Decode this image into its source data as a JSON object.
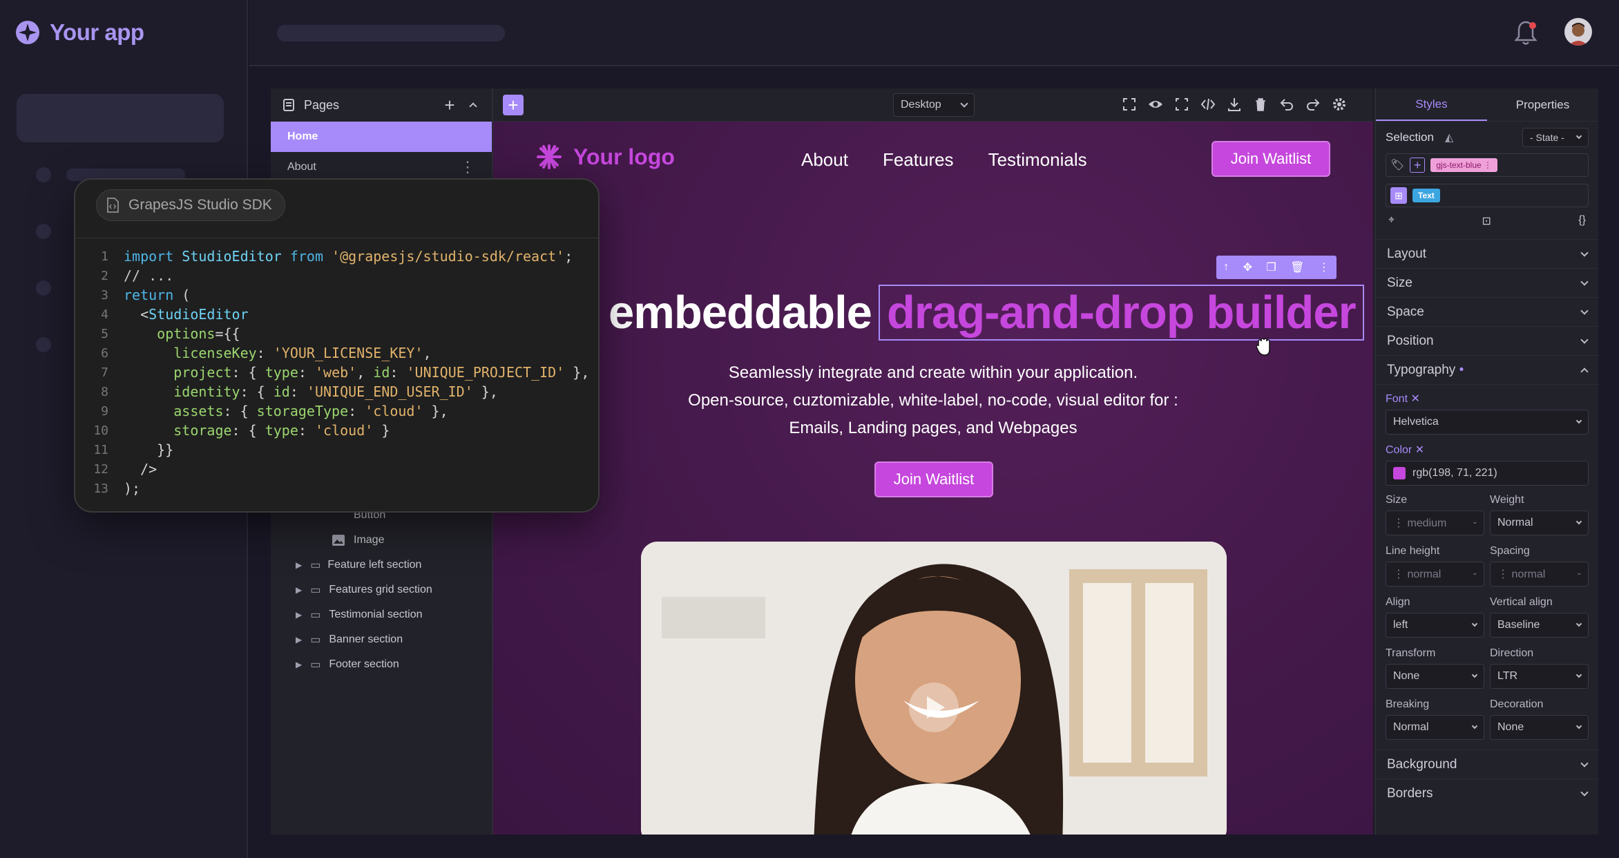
{
  "app": {
    "name": "Your app"
  },
  "pages_panel": {
    "title": "Pages",
    "pages": [
      {
        "label": "Home",
        "active": true
      },
      {
        "label": "About",
        "active": false
      }
    ],
    "layers": [
      {
        "label": "Button",
        "indent": 2
      },
      {
        "label": "Image",
        "indent": 2
      },
      {
        "label": "Feature left section",
        "indent": 1
      },
      {
        "label": "Features grid section",
        "indent": 1
      },
      {
        "label": "Testimonial section",
        "indent": 1
      },
      {
        "label": "Banner section",
        "indent": 1
      },
      {
        "label": "Footer section",
        "indent": 1
      }
    ]
  },
  "canvas_toolbar": {
    "device": "Desktop"
  },
  "site": {
    "logo": "Your logo",
    "nav": [
      "About",
      "Features",
      "Testimonials"
    ],
    "cta_label": "Join Waitlist",
    "hero_plain": "embeddable",
    "hero_highlight": "drag-and-drop builder",
    "subtitle": [
      "Seamlessly integrate and create within your application.",
      "Open-source, cuztomizable, white-label, no-code, visual editor for :",
      "Emails, Landing pages, and Webpages"
    ],
    "hero_button": "Join Waitlist"
  },
  "code_card": {
    "tab_label": "GrapesJS Studio SDK",
    "lines": [
      "1",
      "2",
      "3",
      "4",
      "5",
      "6",
      "7",
      "8",
      "9",
      "10",
      "11",
      "12",
      "13"
    ]
  },
  "right_panel": {
    "tabs": [
      "Styles",
      "Properties"
    ],
    "selection_label": "Selection",
    "state_label": "- State -",
    "class_tag": "gjs-text-blue",
    "component_tag": "Text",
    "sections_top": [
      "Layout",
      "Size",
      "Space",
      "Position"
    ],
    "typography": "Typography",
    "font_label": "Font",
    "font_value": "Helvetica",
    "color_label": "Color",
    "color_value": "rgb(198, 71, 221)",
    "color_swatch": "#c647dd",
    "size_label": "Size",
    "size_value": "medium",
    "weight_label": "Weight",
    "weight_value": "Normal",
    "line_height_label": "Line height",
    "line_height_value": "normal",
    "spacing_label": "Spacing",
    "spacing_value": "normal",
    "align_label": "Align",
    "align_value": "left",
    "valign_label": "Vertical align",
    "valign_value": "Baseline",
    "transform_label": "Transform",
    "transform_value": "None",
    "direction_label": "Direction",
    "direction_value": "LTR",
    "breaking_label": "Breaking",
    "breaking_value": "Normal",
    "decoration_label": "Decoration",
    "decoration_value": "None",
    "sections_bottom": [
      "Background",
      "Borders"
    ]
  },
  "colors": {
    "accent": "#a78bfa",
    "brand_pink": "#c647dd",
    "canvas_bg": "#461a4c"
  }
}
